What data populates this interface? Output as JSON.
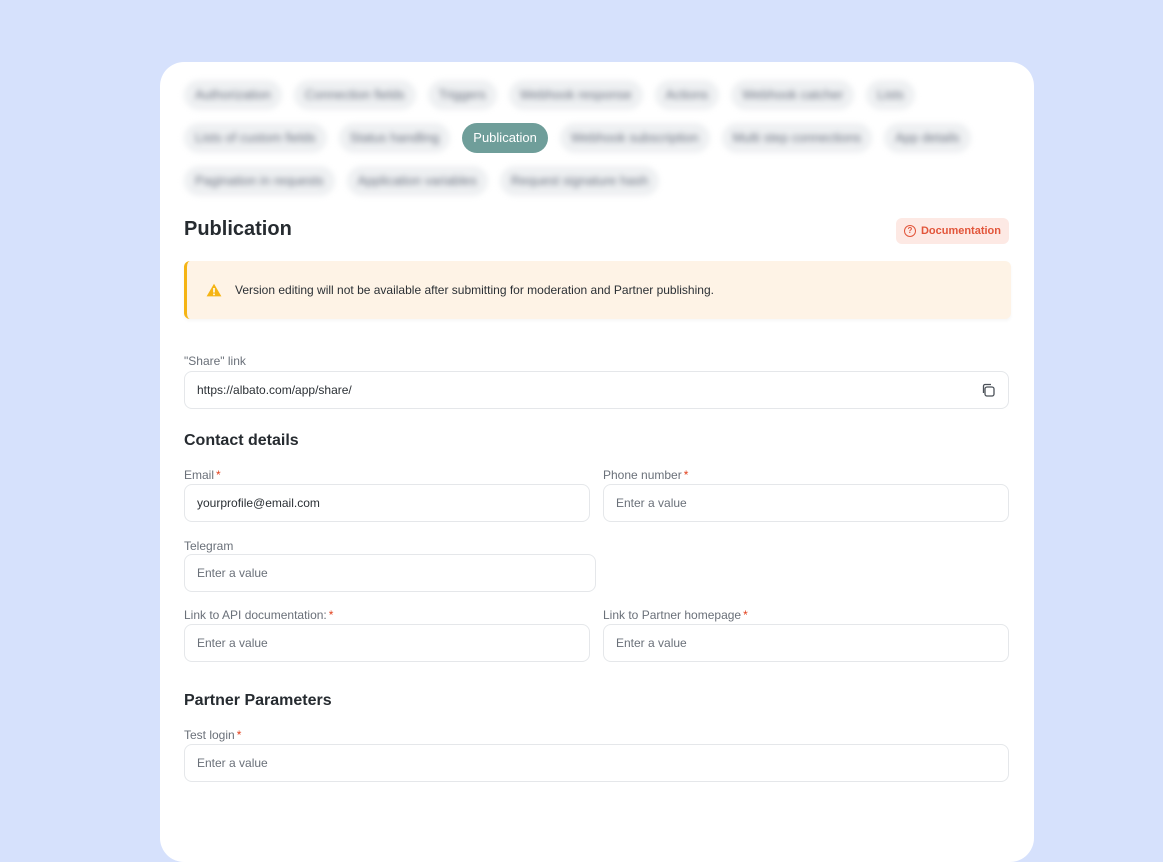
{
  "tabs": [
    [
      "Authorization",
      "Connection fields",
      "Triggers",
      "Webhook response",
      "Actions",
      "Webhook catcher",
      "Lists"
    ],
    [
      "Lists of custom fields",
      "Status handling",
      "Publication",
      "Webhook subscription",
      "Multi step connections",
      "App details"
    ],
    [
      "Pagination in requests",
      "Application variables",
      "Request signature hash"
    ]
  ],
  "active_tab": "Publication",
  "page_title": "Publication",
  "doc_button": "Documentation",
  "alert_text": "Version editing will not be available after submitting for moderation and Partner publishing.",
  "share": {
    "label": "\"Share\" link",
    "value": "https://albato.com/app/share/"
  },
  "contact_section": "Contact details",
  "email": {
    "label": "Email",
    "value": "yourprofile@email.com"
  },
  "phone": {
    "label": "Phone number",
    "placeholder": "Enter a value"
  },
  "telegram": {
    "label": "Telegram",
    "placeholder": "Enter a value"
  },
  "api_doc": {
    "label": "Link to API documentation:",
    "placeholder": "Enter a value"
  },
  "homepage": {
    "label": "Link to Partner homepage",
    "placeholder": "Enter a value"
  },
  "partner_section": "Partner Parameters",
  "test_login": {
    "label": "Test login",
    "placeholder": "Enter a value"
  },
  "required_mark": "*",
  "colors": {
    "accent": "#6f9e9a",
    "warning": "#f5b414",
    "required": "#e2401c",
    "doc": "#e2553a"
  }
}
